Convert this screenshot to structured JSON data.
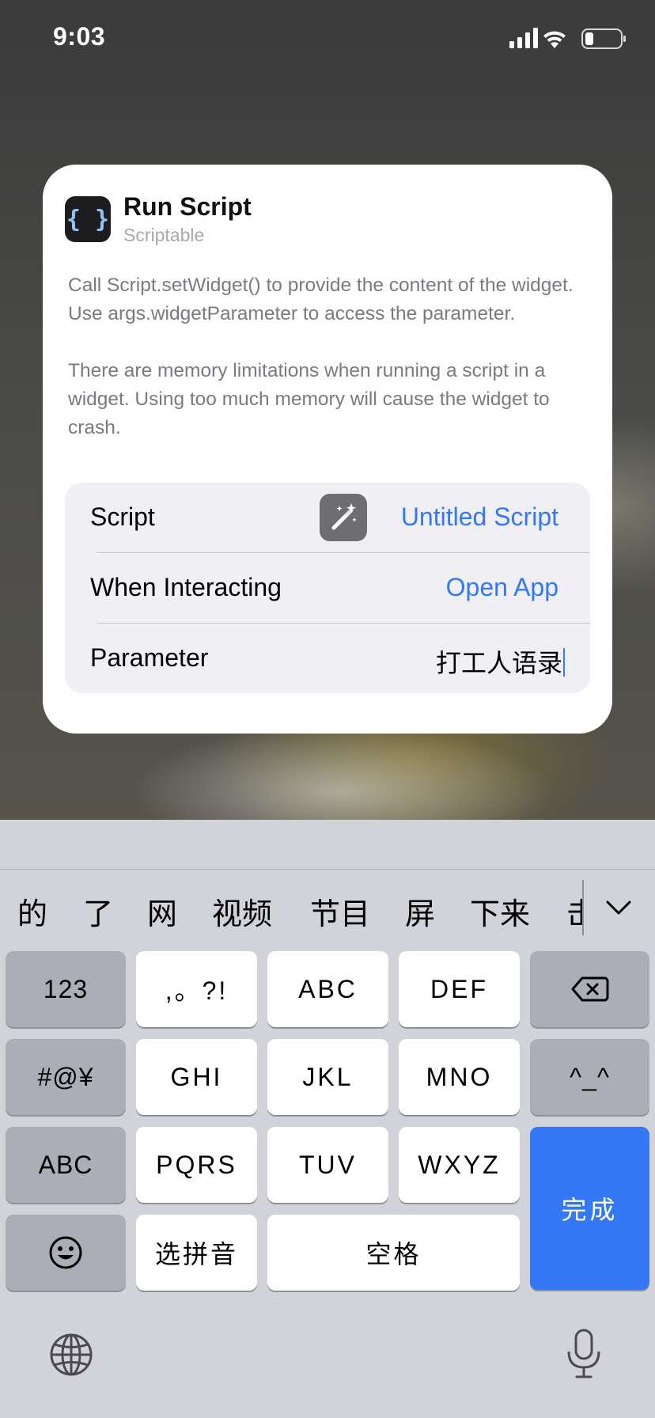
{
  "status_bar": {
    "time": "9:03"
  },
  "card": {
    "app_icon_glyph": "{ }",
    "title": "Run Script",
    "subtitle": "Scriptable",
    "description_1": "Call Script.setWidget() to provide the content of the widget. Use args.widgetParameter to access the parameter.",
    "description_2": "There are memory limitations when running a script in a widget. Using too much memory will cause the widget to crash.",
    "rows": {
      "script": {
        "label": "Script",
        "value": "Untitled Script"
      },
      "interacting": {
        "label": "When Interacting",
        "value": "Open App"
      },
      "parameter": {
        "label": "Parameter",
        "value": "打工人语录"
      }
    },
    "accent_color": "#3478f6"
  },
  "keyboard": {
    "candidates": [
      "的",
      "了",
      "网",
      "视频",
      "节目",
      "屏",
      "下来",
      "击"
    ],
    "keys": {
      "num": "123",
      "punct": ",。?!",
      "abc_group": "ABC",
      "def_group": "DEF",
      "symbols": "#@¥",
      "ghi": "GHI",
      "jkl": "JKL",
      "mno": "MNO",
      "kaomoji": "^_^",
      "abc_switch": "ABC",
      "pqrs": "PQRS",
      "tuv": "TUV",
      "wxyz": "WXYZ",
      "done": "完成",
      "pinyin": "选拼音",
      "space": "空格"
    }
  }
}
